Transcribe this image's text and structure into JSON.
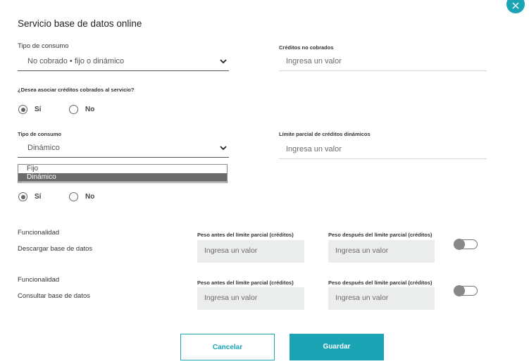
{
  "dialog": {
    "title": "Servicio base de datos online"
  },
  "section1": {
    "consumption_label": "Tipo de consumo",
    "consumption_value": "No cobrado • fijo o dinámico",
    "uncharged_label": "Créditos no cobrados",
    "uncharged_placeholder": "Ingresa un valor",
    "associate_question": "¿Desea asociar créditos cobrados al servicio?",
    "yes_label": "Sí",
    "no_label": "No"
  },
  "section2": {
    "consumption_label": "Tipo de consumo",
    "consumption_value": "Dinámico",
    "dropdown_options": [
      "Fijo",
      "Dinámico"
    ],
    "limit_label": "Límite parcial de créditos dinámicos",
    "limit_placeholder": "Ingresa un valor",
    "yes_label": "Sí",
    "no_label": "No"
  },
  "functionalities": [
    {
      "heading": "Funcionalidad",
      "name": "Descargar base de datos",
      "before_label": "Peso antes del límite parcial (créditos)",
      "before_placeholder": "Ingresa un valor",
      "after_label": "Peso después del límite parcial (créditos)",
      "after_placeholder": "Ingresa un valor"
    },
    {
      "heading": "Funcionalidad",
      "name": "Consultar base de datos",
      "before_label": "Peso antes del límite parcial (créditos)",
      "before_placeholder": "Ingresa un valor",
      "after_label": "Peso después del límite parcial (créditos)",
      "after_placeholder": "Ingresa un valor"
    }
  ],
  "actions": {
    "cancel_label": "Cancelar",
    "save_label": "Guardar"
  },
  "colors": {
    "accent": "#1aa4b4",
    "input_bg": "#ebeded",
    "selected_option_bg": "#6b6b6b"
  },
  "icons": {
    "close": "close-icon",
    "chevron": "chevron-down-icon"
  }
}
